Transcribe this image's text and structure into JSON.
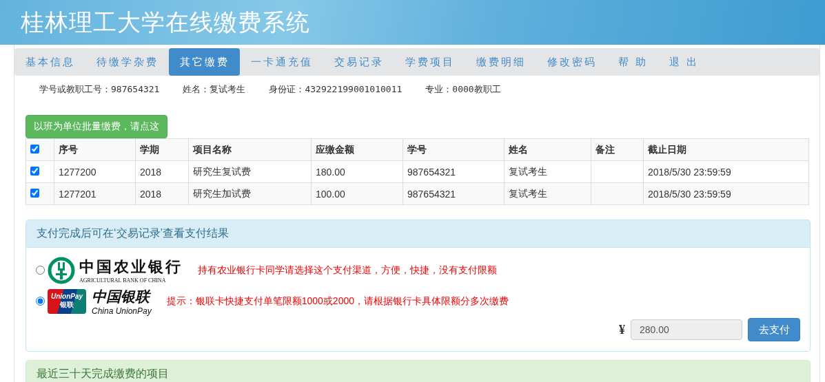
{
  "header": {
    "title": "桂林理工大学在线缴费系统"
  },
  "nav": [
    {
      "label": "基本信息",
      "selected": false
    },
    {
      "label": "待缴学杂费",
      "selected": false
    },
    {
      "label": "其它缴费",
      "selected": true
    },
    {
      "label": "一卡通充值",
      "selected": false
    },
    {
      "label": "交易记录",
      "selected": false
    },
    {
      "label": "学费项目",
      "selected": false
    },
    {
      "label": "缴费明细",
      "selected": false
    },
    {
      "label": "修改密码",
      "selected": false
    },
    {
      "label": "帮 助",
      "selected": false
    },
    {
      "label": "退 出",
      "selected": false
    }
  ],
  "user_info": [
    "学号或教职工号：987654321",
    "姓名：复试考生",
    "身份证：432922199001010011",
    "专业：0000教职工"
  ],
  "batch_button": "以班为单位批量缴费，请点这",
  "table": {
    "select_all_checked": true,
    "columns": [
      "序号",
      "学期",
      "项目名称",
      "应缴金额",
      "学号",
      "姓名",
      "备注",
      "截止日期"
    ],
    "rows": [
      {
        "checked": true,
        "cells": [
          "1277200",
          "2018",
          "研究生复试费",
          "180.00",
          "987654321",
          "复试考生",
          "",
          "2018/5/30 23:59:59"
        ]
      },
      {
        "checked": true,
        "cells": [
          "1277201",
          "2018",
          "研究生加试费",
          "100.00",
          "987654321",
          "复试考生",
          "",
          "2018/5/30 23:59:59"
        ]
      }
    ]
  },
  "payment_panel": {
    "heading": "支付完成后可在‘交易记录’查看支付结果",
    "options": [
      {
        "kind": "abc",
        "selected": false,
        "logo_name": "中国农业银行",
        "logo_subtitle": "AGRICULTURAL BANK OF CHINA",
        "note": "持有农业银行卡同学请选择这个支付渠道，方便，快捷，没有支付限额"
      },
      {
        "kind": "unionpay",
        "selected": true,
        "badge_top": "UnionPay",
        "badge_bottom": "银联",
        "logo_name": "中国银联",
        "logo_subtitle": "China UnionPay",
        "note": "提示：银联卡快捷支付单笔限额1000或2000，请根据银行卡具体限额分多次缴费"
      }
    ],
    "currency": "¥",
    "amount": "280.00",
    "pay_button": "去支付"
  },
  "recent_panel": {
    "heading": "最近三十天完成缴费的项目"
  }
}
